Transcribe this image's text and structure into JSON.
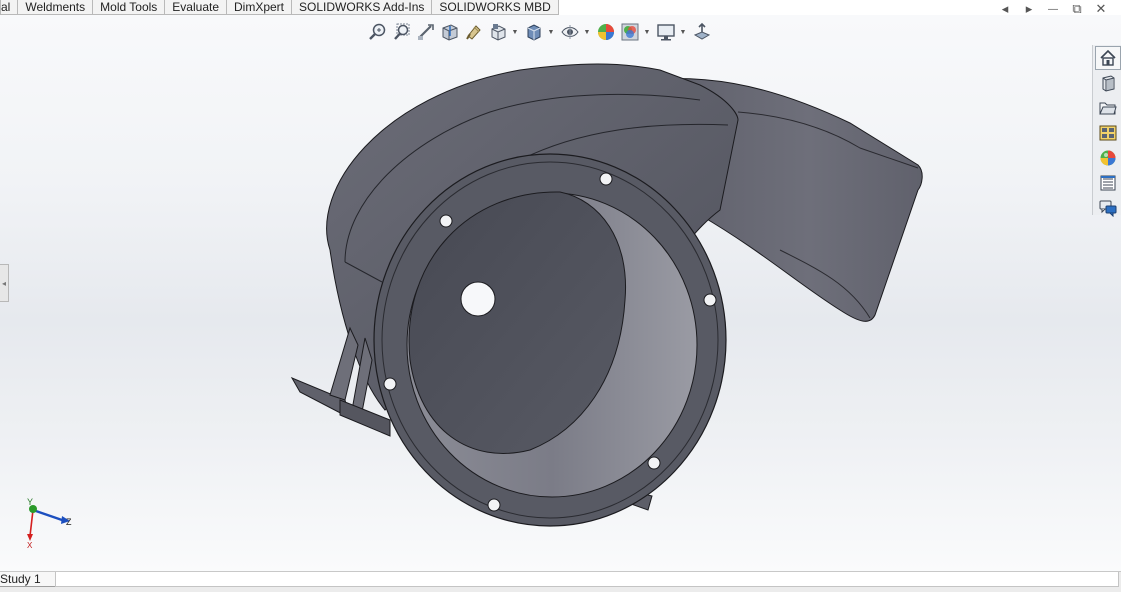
{
  "command_tabs": [
    "al",
    "Weldments",
    "Mold Tools",
    "Evaluate",
    "DimXpert",
    "SOLIDWORKS Add-Ins",
    "SOLIDWORKS MBD"
  ],
  "window_controls": {
    "prev_icon": "◂",
    "next_icon": "▸",
    "minimize_icon": "—",
    "restore_icon": "⧉",
    "close_icon": "✕"
  },
  "heads_up_toolbar": [
    "zoom-to-fit-icon",
    "zoom-to-area-icon",
    "previous-view-icon",
    "section-view-icon",
    "dynamic-annotation-icon",
    "view-orientation-icon",
    "display-style-icon",
    "hide-show-items-icon",
    "edit-appearance-icon",
    "apply-scene-icon",
    "view-settings-icon",
    "rotate-view-icon"
  ],
  "task_pane": [
    "solidworks-resources-icon",
    "design-library-icon",
    "file-explorer-icon",
    "view-palette-icon",
    "appearances-scenes-icon",
    "custom-properties-icon",
    "forum-icon"
  ],
  "triad": {
    "x_label": "X",
    "y_label": "Y",
    "z_label": "Z"
  },
  "status_bar": {
    "study_tab": "Study 1"
  },
  "colors": {
    "model_body": "#5b5c67",
    "model_dark": "#484a54",
    "model_light": "#7a7b86",
    "accent_blue": "#1f5fb8"
  }
}
